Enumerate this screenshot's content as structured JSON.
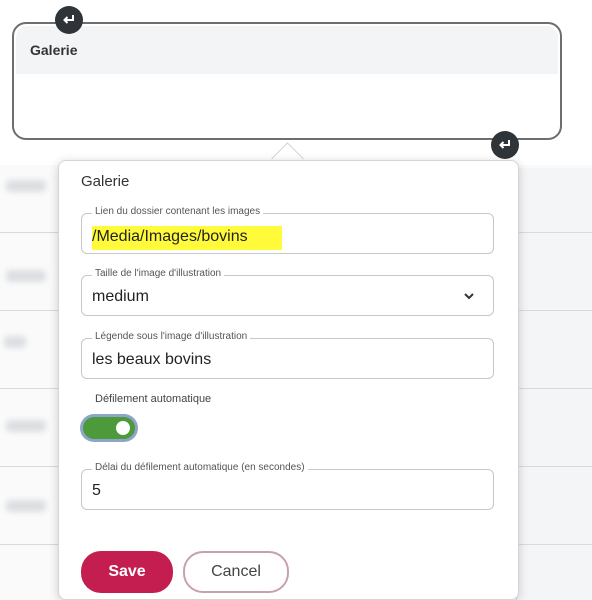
{
  "block": {
    "title": "Galerie",
    "handle_icon": "return-arrow-icon"
  },
  "popup": {
    "title": "Galerie",
    "fields": {
      "folder_link": {
        "label": "Lien du dossier contenant les images",
        "value": "/Media/Images/bovins"
      },
      "image_size": {
        "label": "Taille de l'image d'illustration",
        "value": "medium"
      },
      "caption": {
        "label": "Légende sous l'image d'illustration",
        "value": "les beaux bovins"
      },
      "autoscroll": {
        "label": "Défilement automatique",
        "enabled": true
      },
      "autoscroll_delay": {
        "label": "Délai du défilement automatique (en secondes)",
        "value": "5"
      }
    },
    "buttons": {
      "save": "Save",
      "cancel": "Cancel"
    }
  },
  "colors": {
    "save": "#c41d4f",
    "toggle_on": "#4c9a3a",
    "highlight": "#fffa3a"
  }
}
